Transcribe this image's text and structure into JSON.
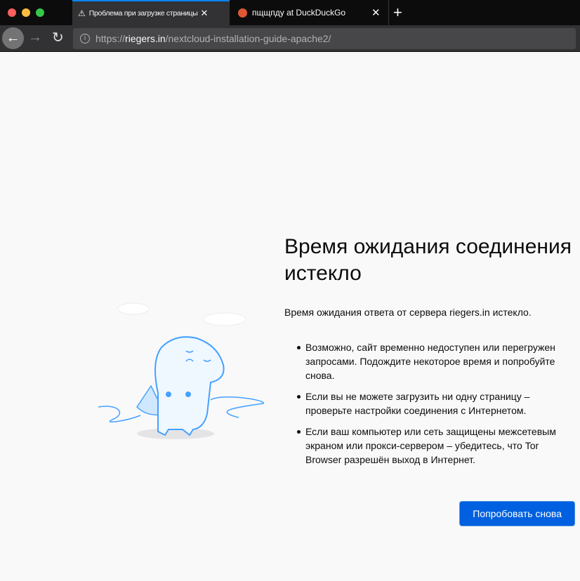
{
  "tabs": [
    {
      "title": "Проблема при загрузке страницы",
      "icon": "warning-icon"
    },
    {
      "title": "пщщпду at DuckDuckGo",
      "icon": "duckduckgo-icon"
    }
  ],
  "url": {
    "scheme": "https://",
    "host": "riegers.in",
    "path": "/nextcloud-installation-guide-apache2/"
  },
  "error": {
    "title": "Время ожидания соединения истекло",
    "description": "Время ожидания ответа от сервера riegers.in истекло.",
    "bullets": [
      "Возможно, сайт временно недоступен или перегружен запросами. Подождите некоторое время и попробуйте снова.",
      "Если вы не можете загрузить ни одну страницу – проверьте настройки соединения с Интернетом.",
      "Если ваш компьютер или сеть защищены межсетевым экраном или прокси-сервером – убедитесь, что Tor Browser разрешён выход в Интернет."
    ],
    "retry_label": "Попробовать снова"
  },
  "colors": {
    "accent": "#0060df",
    "tab_indicator": "#0a84ff"
  }
}
